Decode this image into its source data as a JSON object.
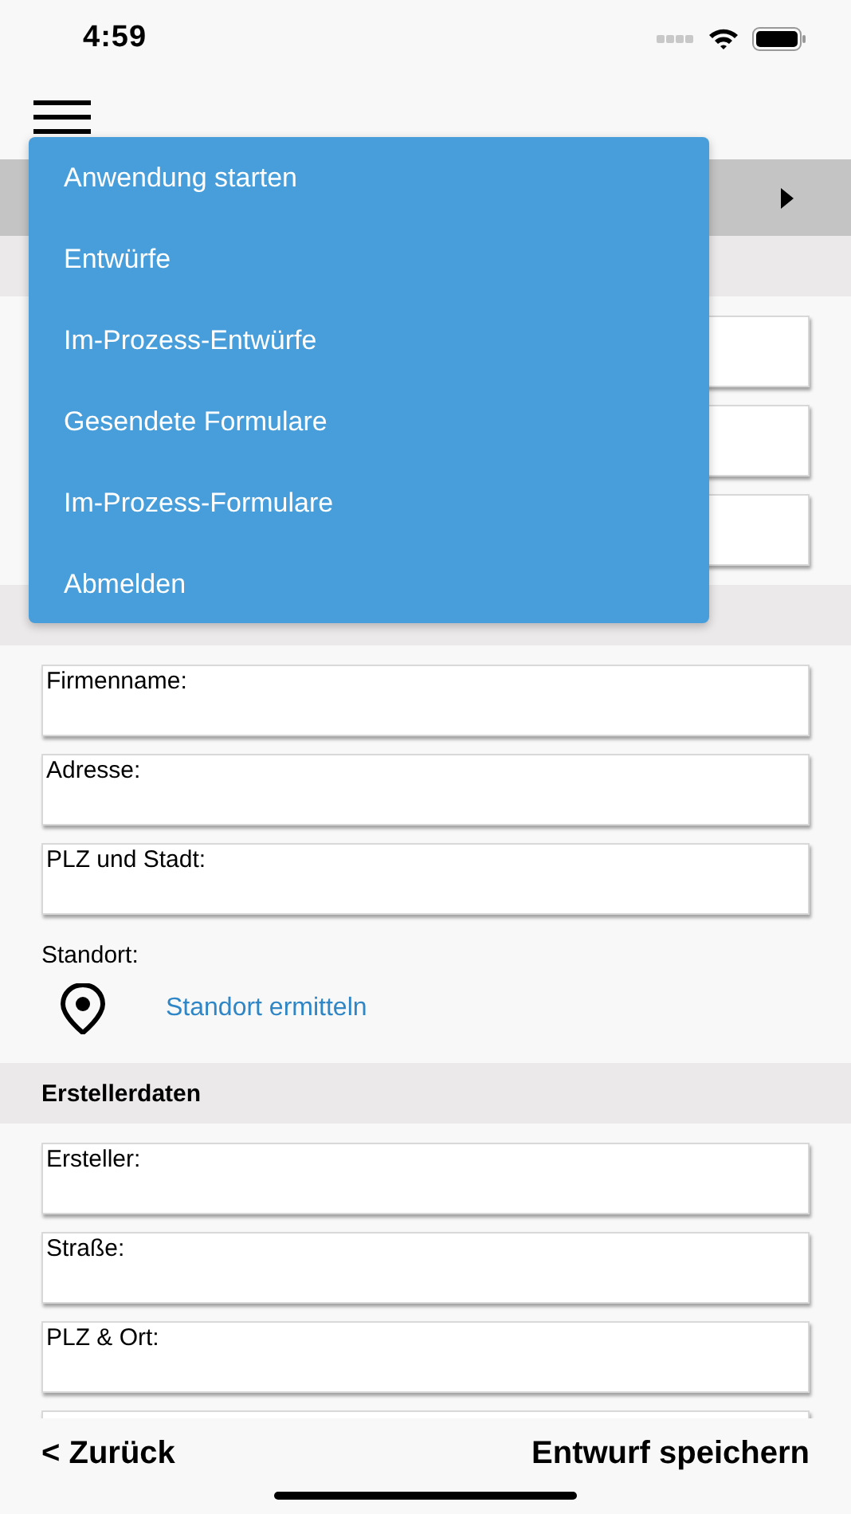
{
  "status_bar": {
    "time": "4:59"
  },
  "menu": {
    "items": [
      {
        "label": "Anwendung starten"
      },
      {
        "label": "Entwürfe"
      },
      {
        "label": "Im-Prozess-Entwürfe"
      },
      {
        "label": "Gesendete Formulare"
      },
      {
        "label": "Im-Prozess-Formulare"
      },
      {
        "label": "Abmelden"
      }
    ]
  },
  "sections": [
    {
      "items": [
        {
          "kind": "field"
        },
        {
          "kind": "field"
        },
        {
          "kind": "field"
        }
      ]
    },
    {
      "items": [
        {
          "kind": "field",
          "label": "Firmenname:"
        },
        {
          "kind": "field",
          "label": "Adresse:"
        },
        {
          "kind": "field",
          "label": "PLZ und Stadt:"
        },
        {
          "kind": "label",
          "label": "Standort:"
        },
        {
          "kind": "location",
          "link": "Standort ermitteln"
        }
      ]
    },
    {
      "title": "Erstellerdaten",
      "items": [
        {
          "kind": "field",
          "label": "Ersteller:"
        },
        {
          "kind": "field",
          "label": "Straße:"
        },
        {
          "kind": "field",
          "label": "PLZ & Ort:"
        },
        {
          "kind": "field"
        }
      ]
    }
  ],
  "footer": {
    "back": "< Zurück",
    "save": "Entwurf speichern"
  }
}
